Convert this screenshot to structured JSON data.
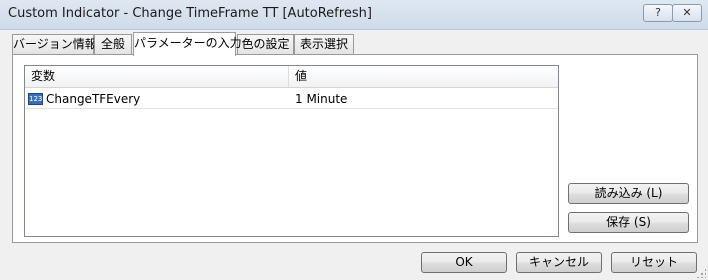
{
  "window": {
    "title": "Custom Indicator - Change TimeFrame TT [AutoRefresh]",
    "help_label": "?",
    "close_label": "✕"
  },
  "tabs": [
    {
      "label": "バージョン情報"
    },
    {
      "label": "全般"
    },
    {
      "label": "パラメーターの入力",
      "active": true
    },
    {
      "label": "色の設定"
    },
    {
      "label": "表示選択"
    }
  ],
  "params_table": {
    "headers": [
      "変数",
      "値"
    ],
    "rows": [
      {
        "icon": "123",
        "name": "ChangeTFEvery",
        "value": "1 Minute"
      }
    ]
  },
  "side_buttons": {
    "load_label": "読み込み (L)",
    "save_label": "保存 (S)"
  },
  "footer_buttons": {
    "ok_label": "OK",
    "cancel_label": "キャンセル",
    "reset_label": "リセット"
  }
}
